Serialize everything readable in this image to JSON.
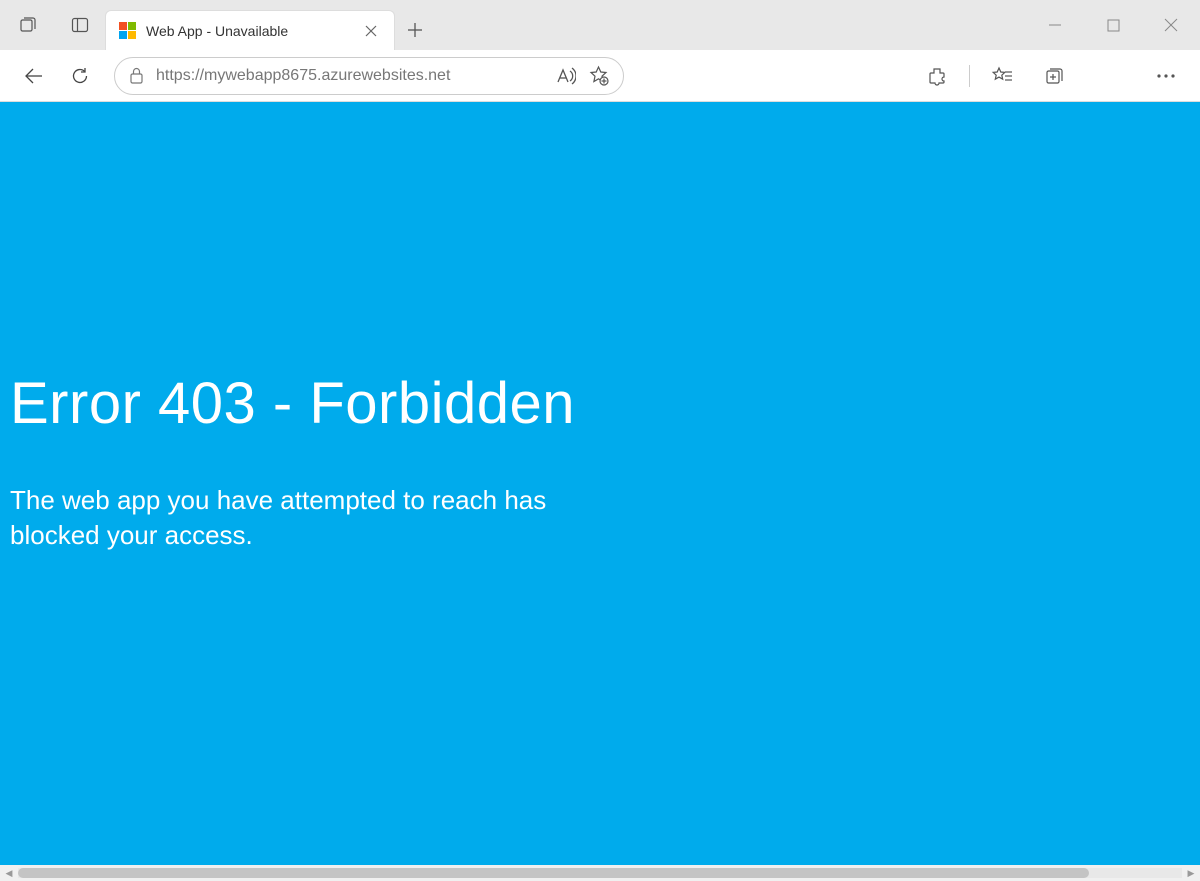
{
  "tab": {
    "title": "Web App - Unavailable"
  },
  "address": {
    "url": "https://mywebapp8675.azurewebsites.net"
  },
  "page": {
    "error_title": "Error 403 - Forbidden",
    "error_message": "The web app you have attempted to reach has blocked your access."
  },
  "colors": {
    "page_background": "#00abec",
    "text": "#ffffff"
  }
}
